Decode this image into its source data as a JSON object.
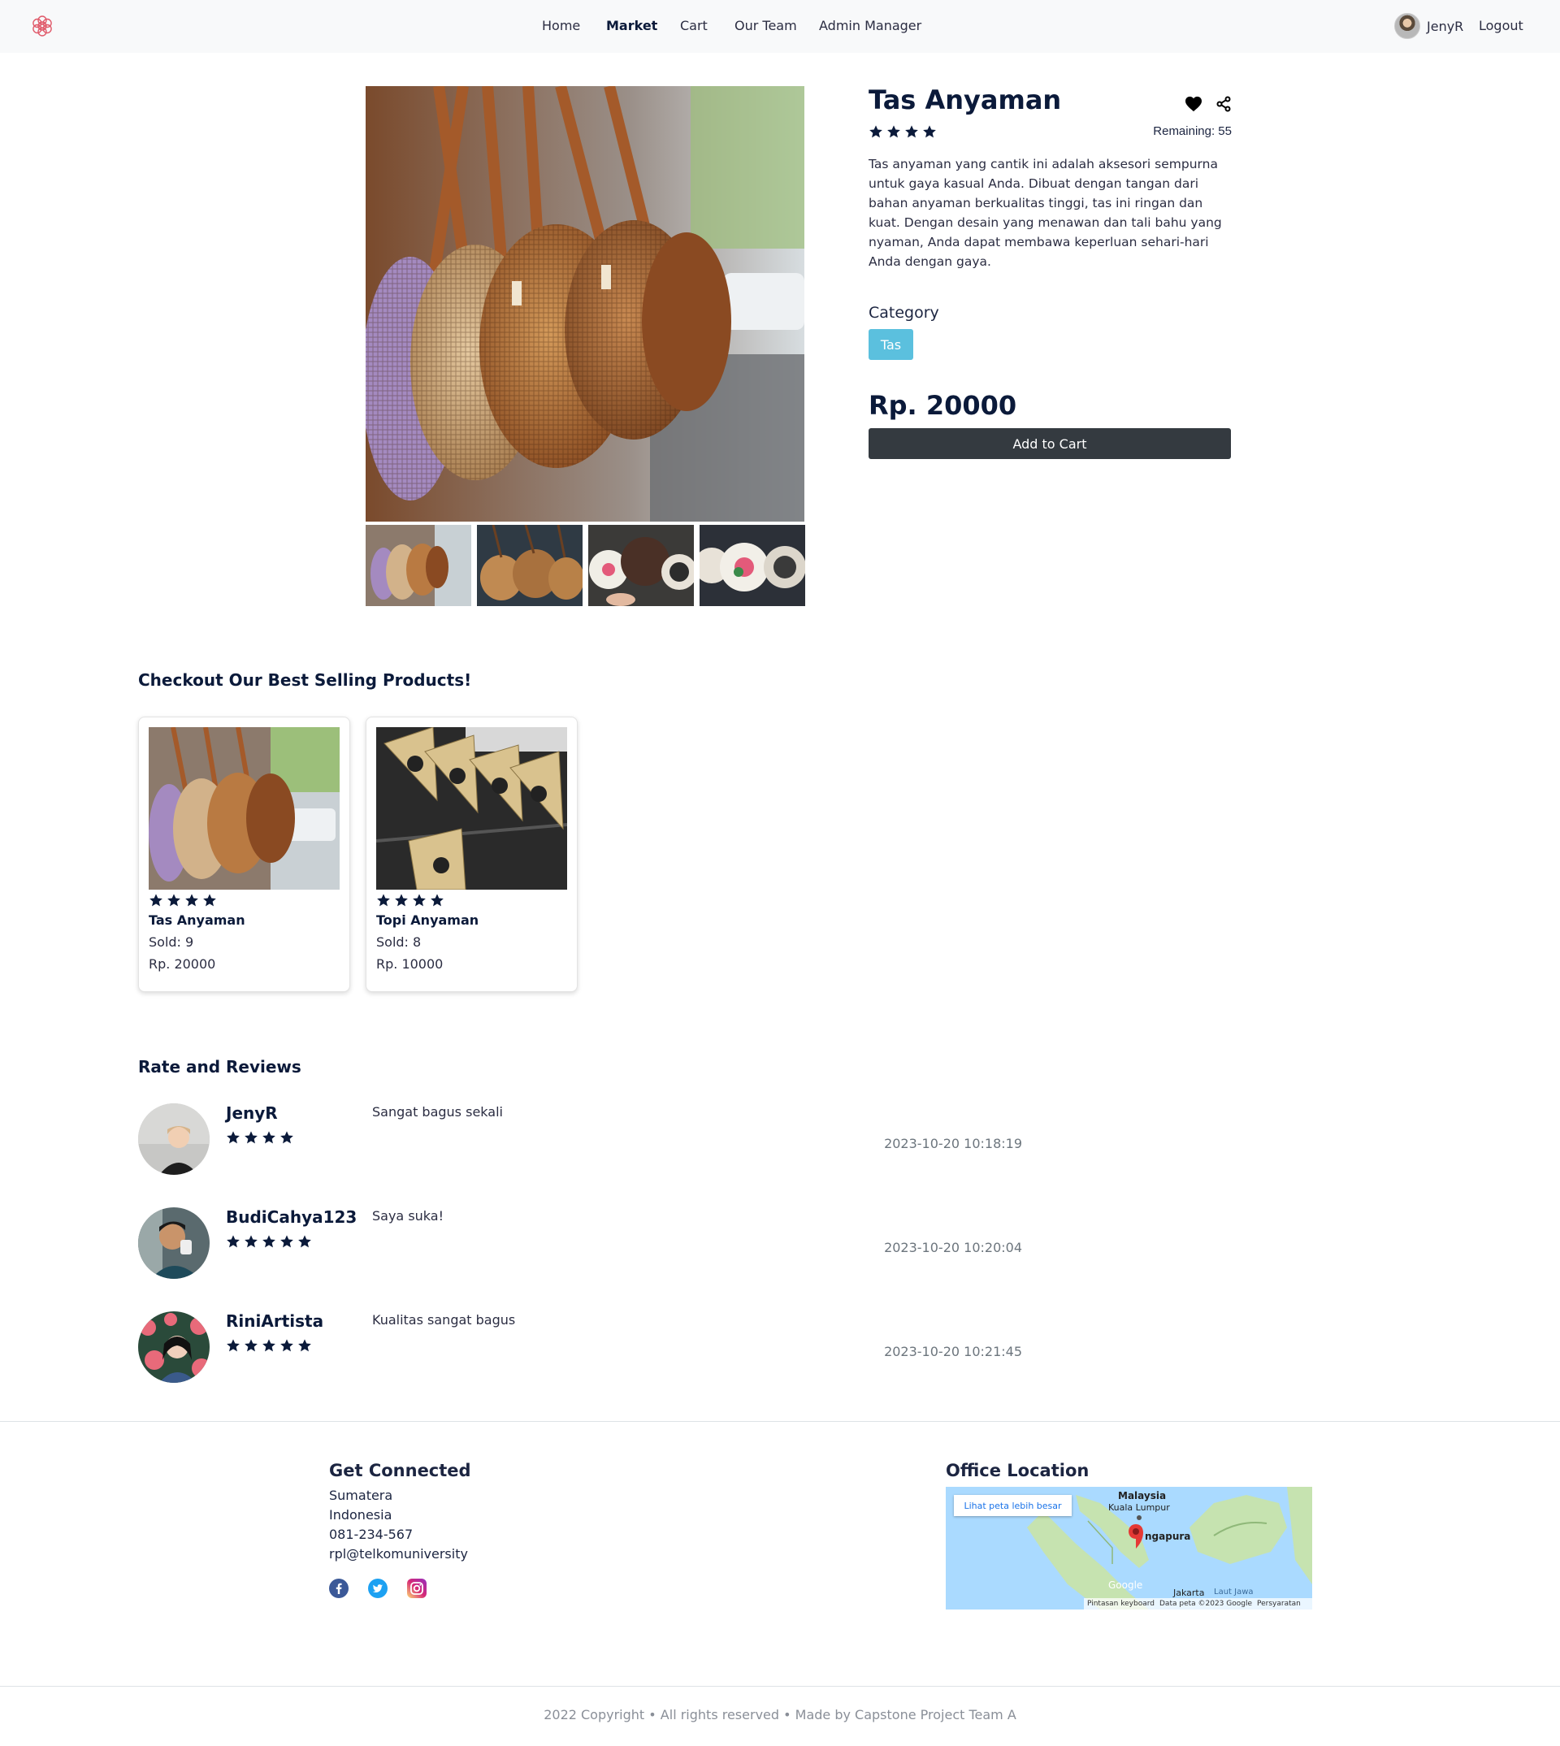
{
  "nav": {
    "links": [
      "Home",
      "Market",
      "Cart",
      "Our Team",
      "Admin Manager"
    ],
    "active": "Market",
    "user": "JenyR",
    "logout": "Logout"
  },
  "product": {
    "title": "Tas Anyaman",
    "rating_stars": 4,
    "remaining": "Remaining: 55",
    "description": "Tas anyaman yang cantik ini adalah aksesori sempurna untuk gaya kasual Anda. Dibuat dengan tangan dari bahan anyaman berkualitas tinggi, tas ini ringan dan kuat. Dengan desain yang menawan dan tali bahu yang nyaman, Anda dapat membawa keperluan sehari-hari Anda dengan gaya.",
    "category_label": "Category",
    "category": "Tas",
    "price": "Rp. 20000",
    "add_to_cart": "Add to Cart",
    "thumbnail_count": 4
  },
  "best_selling": {
    "title": "Checkout Our Best Selling Products!",
    "items": [
      {
        "name": "Tas Anyaman",
        "stars": 4,
        "sold": "Sold: 9",
        "price": "Rp. 20000"
      },
      {
        "name": "Topi Anyaman",
        "stars": 4,
        "sold": "Sold: 8",
        "price": "Rp. 10000"
      }
    ]
  },
  "reviews": {
    "title": "Rate and Reviews",
    "items": [
      {
        "user": "JenyR",
        "stars": 4,
        "text": "Sangat bagus sekali",
        "date": "2023-10-20 10:18:19"
      },
      {
        "user": "BudiCahya123",
        "stars": 5,
        "text": "Saya suka!",
        "date": "2023-10-20 10:20:04"
      },
      {
        "user": "RiniArtista",
        "stars": 5,
        "text": "Kualitas sangat bagus",
        "date": "2023-10-20 10:21:45"
      }
    ]
  },
  "footer": {
    "connected_title": "Get Connected",
    "lines": [
      "Sumatera",
      "Indonesia",
      "081-234-567",
      "rpl@telkomuniversity"
    ],
    "social_icons": [
      "facebook-icon",
      "twitter-icon",
      "instagram-icon"
    ],
    "office_title": "Office Location",
    "map": {
      "link": "Lihat peta lebih besar",
      "labels": [
        "Malaysia",
        "Kuala Lumpur",
        "ngapura",
        "Jakarta",
        "Laut Jawa"
      ],
      "attribution": [
        "Pintasan keyboard",
        "Data peta ©2023 Google",
        "Persyaratan"
      ],
      "brand": "Google"
    },
    "copyright": "2022 Copyright • All rights reserved • Made by Capstone Project Team A"
  },
  "colors": {
    "navy": "#0b1a3a",
    "badge": "#5bc0de",
    "button": "#343a40",
    "navbar": "#f8f9fa"
  }
}
